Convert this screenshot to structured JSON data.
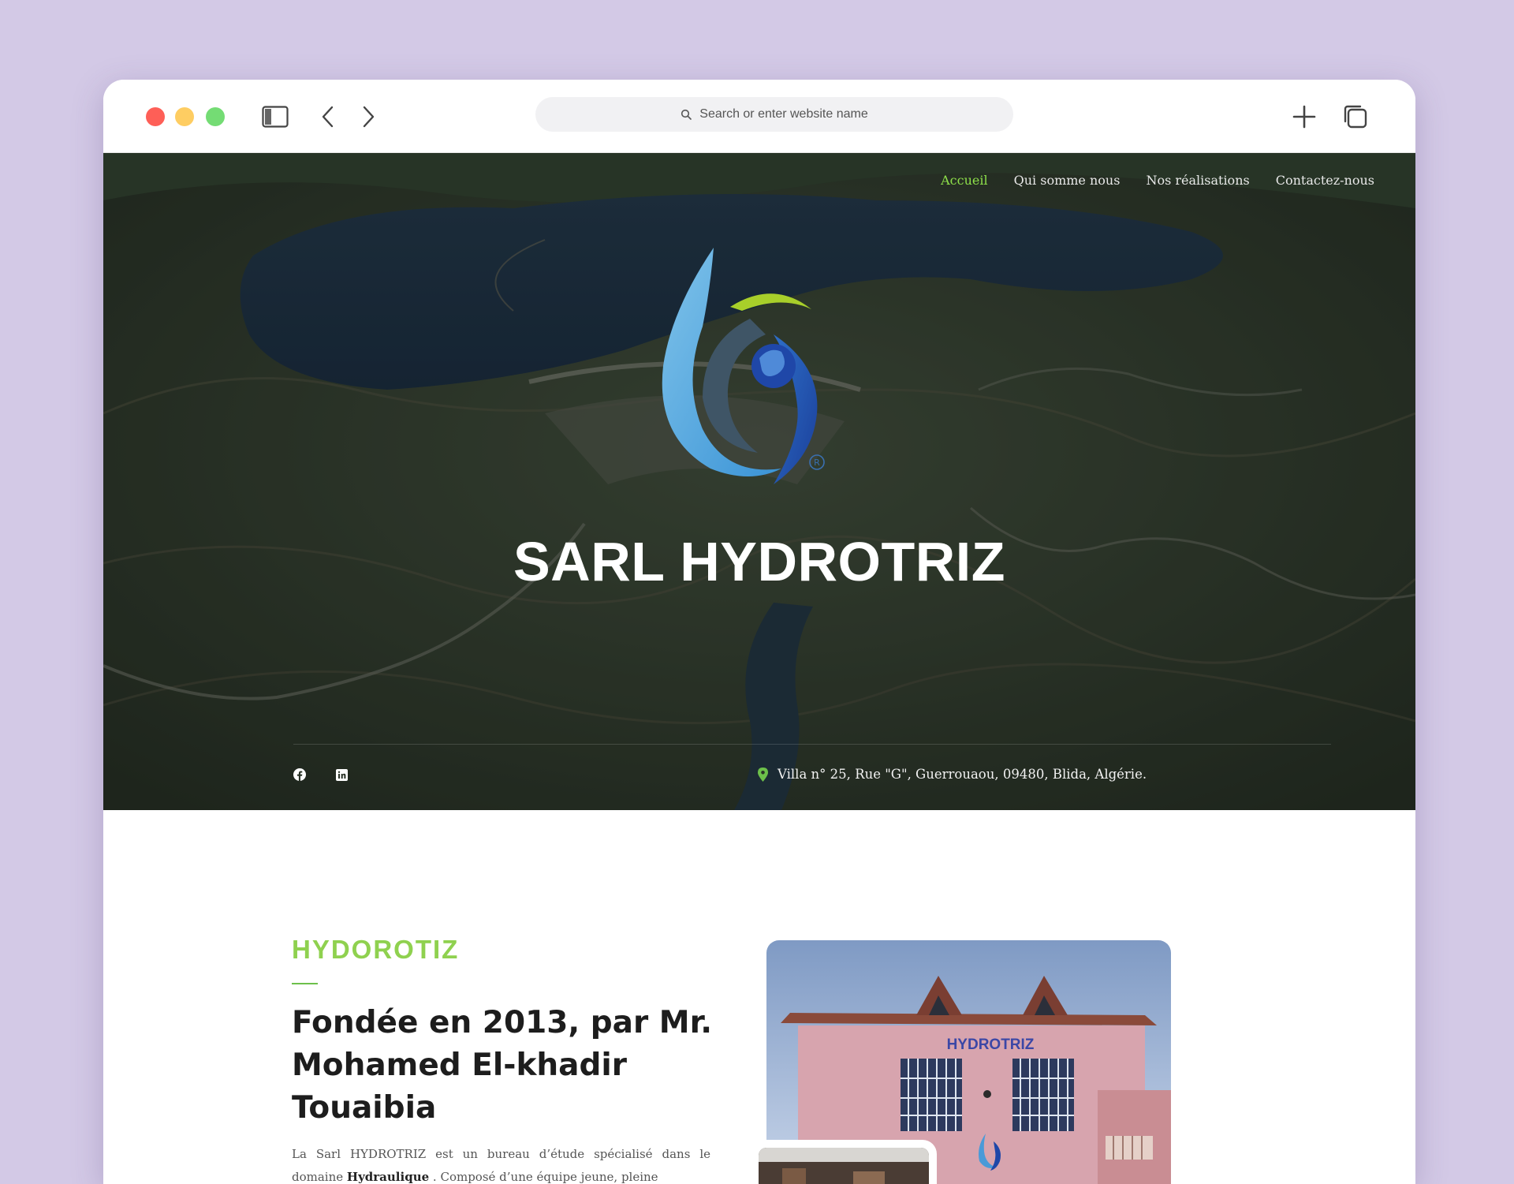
{
  "browser": {
    "address_placeholder": "Search or enter website name"
  },
  "nav": {
    "items": [
      {
        "label": "Accueil",
        "active": true
      },
      {
        "label": "Qui somme nous",
        "active": false
      },
      {
        "label": "Nos réalisations",
        "active": false
      },
      {
        "label": "Contactez-nous",
        "active": false
      }
    ]
  },
  "hero": {
    "title": "SARL HYDROTRIZ",
    "address": "Villa n° 25, Rue \"G\", Guerrouaou, 09480, Blida, Algérie.",
    "social": [
      "facebook-icon",
      "linkedin-icon"
    ]
  },
  "about": {
    "eyebrow": "HYDOROTIZ",
    "heading": "Fondée en 2013, par Mr. Mohamed El-khadir Touaibia",
    "para_start": "La Sarl HYDROTRIZ est un bureau d’étude spécialisé dans le domaine ",
    "para_bold": "Hydraulique",
    "para_end": " . Composé d’une équipe jeune, pleine",
    "building_sign": "HYDROTRIZ"
  },
  "colors": {
    "accent_green": "#8fd14f",
    "page_background": "#d3c9e6",
    "hero_overlay": "#2a3327"
  }
}
